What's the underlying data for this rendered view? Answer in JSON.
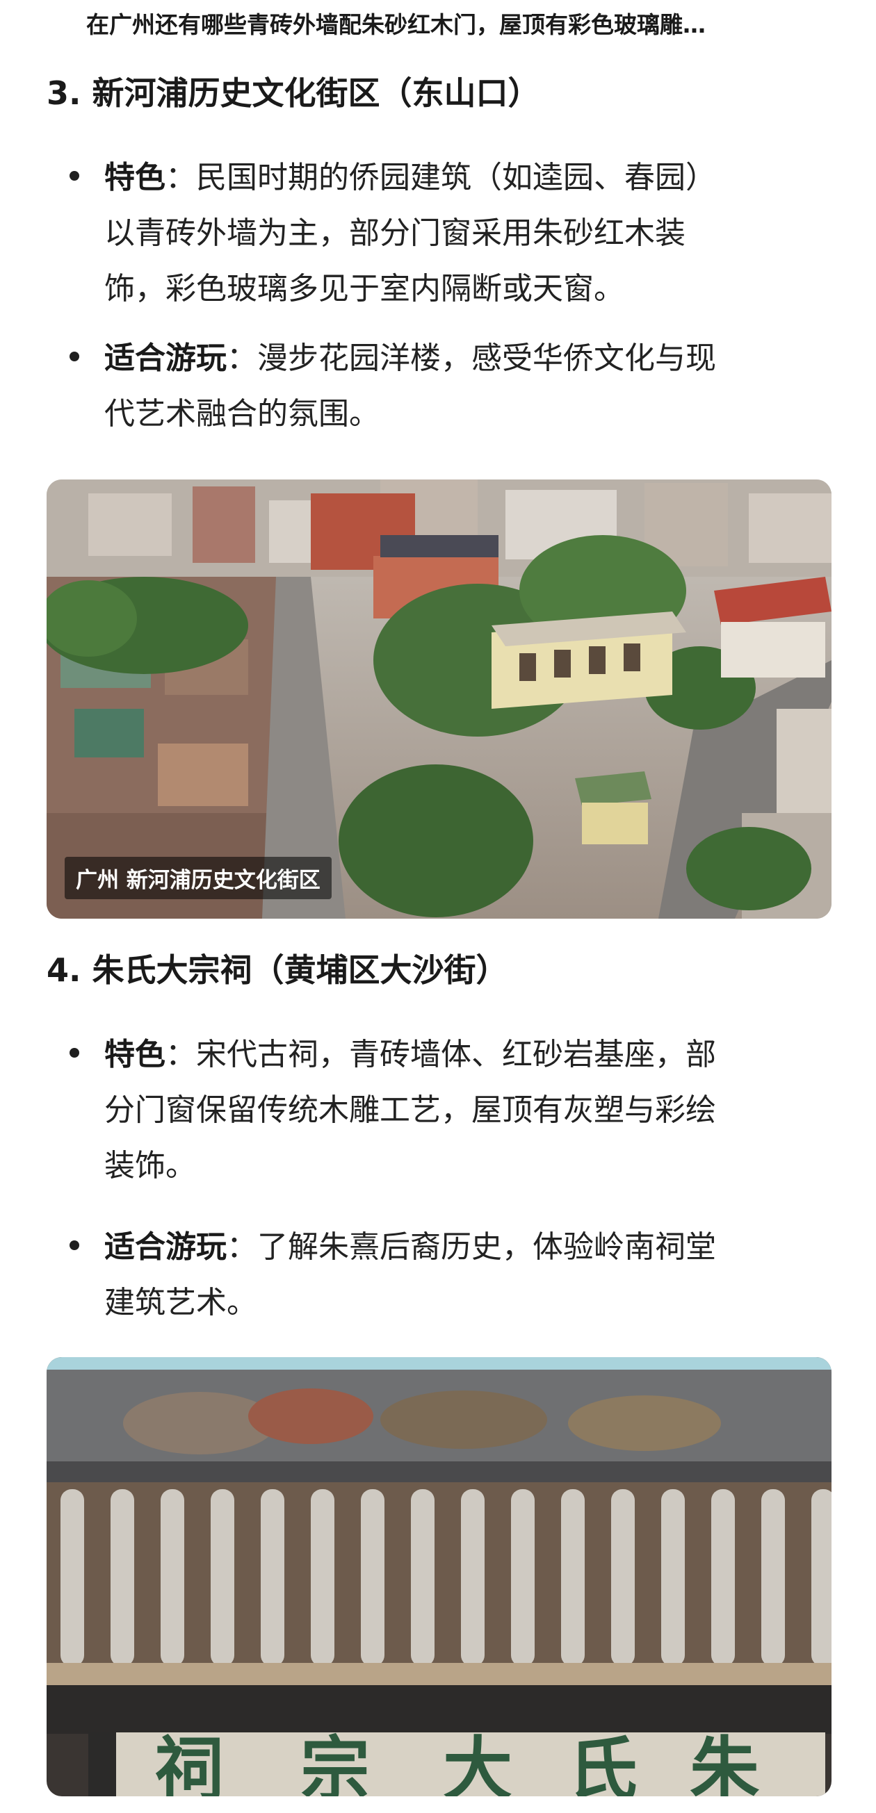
{
  "header": {
    "title": "在广州还有哪些青砖外墙配朱砂红木门，屋顶有彩色玻璃雕…"
  },
  "sections": [
    {
      "heading": "3. 新河浦历史文化街区（东山口）",
      "bullets": [
        {
          "label": "特色",
          "sep": "：",
          "lines": [
            "民国时期的侨园建筑（如逵园、春园）",
            "以青砖外墙为主，部分门窗采用朱砂红木装",
            "饰，彩色玻璃多见于室内隔断或天窗。"
          ]
        },
        {
          "label": "适合游玩",
          "sep": "：",
          "lines": [
            "漫步花园洋楼，感受华侨文化与现",
            "代艺术融合的氛围。"
          ]
        }
      ],
      "image": {
        "caption": "广州 新河浦历史文化街区",
        "icon": "aerial-photo"
      }
    },
    {
      "heading": "4. 朱氏大宗祠（黄埔区大沙街）",
      "bullets": [
        {
          "label": "特色",
          "sep": "：",
          "lines": [
            "宋代古祠，青砖墙体、红砂岩基座，部",
            "分门窗保留传统木雕工艺，屋顶有灰塑与彩绘",
            "装饰。"
          ]
        },
        {
          "label": "适合游玩",
          "sep": "：",
          "lines": [
            "了解朱熹后裔历史，体验岭南祠堂",
            "建筑艺术。"
          ]
        }
      ],
      "image": {
        "plaque": [
          "祠",
          "宗",
          "大",
          "氏",
          "朱"
        ],
        "icon": "ancestral-hall-photo"
      }
    }
  ],
  "colors": {
    "text": "#1f1f1f",
    "roof_red": "#b8483a",
    "plaque_green": "#2e5a3e"
  }
}
